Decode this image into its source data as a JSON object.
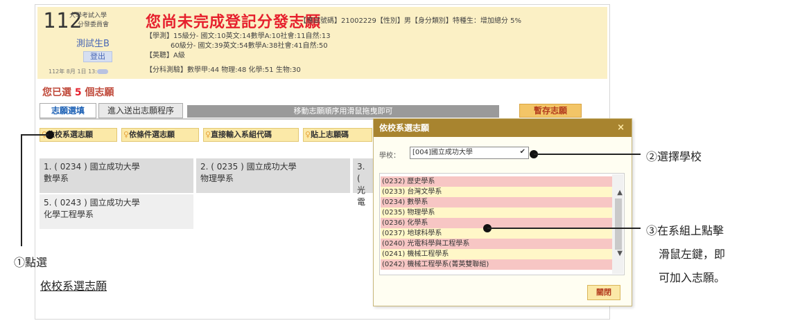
{
  "header": {
    "logo_number": "112",
    "org_line1": "大學考試入學",
    "org_line2": "分發委員會",
    "user_name": "測試生B",
    "logout_label": "登出",
    "login_time": "112年 8月 1日 13:",
    "status_title": "您尚未完成登記分發志願",
    "applicant_info": "【應試號碼】21002229【性別】男【身分類別】特種生：增加總分 5%",
    "gsat_levels_15": "【學測】15級分- 國文:10英文:14數學A:10社會:11自然:13",
    "gsat_levels_60": "60級分- 國文:39英文:54數學A:38社會:41自然:50",
    "english_listening": "【英聽】A級",
    "ast_scores": "【分科測驗】數學甲:44 物理:48 化學:51 生物:30"
  },
  "main": {
    "count_prefix": "您已選",
    "count_value": "5",
    "count_suffix": "個志願",
    "tabs": [
      "志願選填",
      "進入送出志願程序"
    ],
    "drag_hint": "移動志願順序用滑鼠拖曳即可",
    "save_label": "暫存志願",
    "filters": [
      "依校系選志願",
      "依條件選志願",
      "直接輸入系組代碼",
      "貼上志願碼"
    ],
    "choices": [
      {
        "line1": "1. ( 0234 ) 國立成功大學",
        "line2": "數學系"
      },
      {
        "line1": "2. ( 0235 ) 國立成功大學",
        "line2": "物理學系"
      },
      {
        "line1": "3. (",
        "line2": "光電"
      },
      {
        "line1": "5. ( 0243 ) 國立成功大學",
        "line2": "化學工程學系"
      }
    ]
  },
  "dialog": {
    "title": "依校系選志願",
    "close_icon": "×",
    "school_label": "學校：",
    "school_value": "[004]國立成功大學",
    "departments": [
      "(0232) 歷史學系",
      "(0233) 台灣文學系",
      "(0234) 數學系",
      "(0235) 物理學系",
      "(0236) 化學系",
      "(0237) 地球科學系",
      "(0240) 光電科學與工程學系",
      "(0241) 機械工程學系",
      "(0242) 機械工程學系(菁英雙聯組)"
    ],
    "close_button": "關閉"
  },
  "annotations": {
    "step1_line1": "①點選",
    "step1_line2": "依校系選志願",
    "step2": "②選擇學校",
    "step3_line1": "③在系組上點擊",
    "step3_line2": "滑鼠左鍵，即",
    "step3_line3": "可加入志願。"
  },
  "colors": {
    "alert_red": "#e6202d",
    "header_bg": "#fbf0c5",
    "dialog_header": "#a8842f",
    "list_pink": "#f7c6c4",
    "list_yellow": "#fff7c8"
  }
}
